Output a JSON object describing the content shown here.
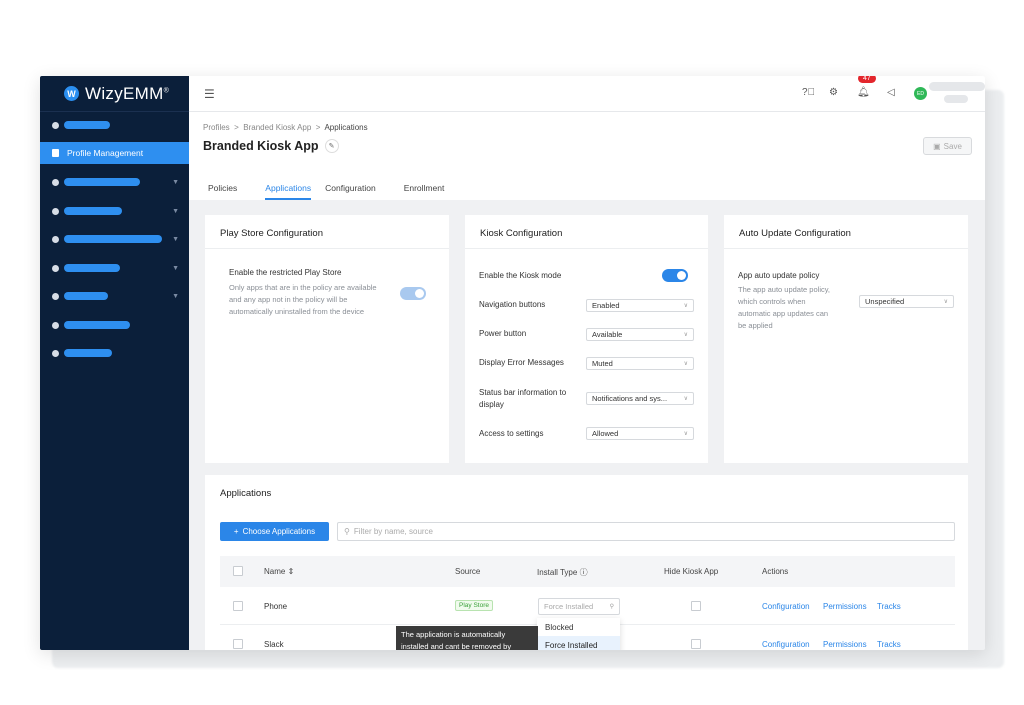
{
  "brand": {
    "name": "WizyEMM",
    "mark": "W",
    "reg": "®"
  },
  "sidebar": {
    "active_item": "Profile Management",
    "colors": {
      "bg": "#0b1f3a",
      "accent": "#2e8ff0"
    }
  },
  "header": {
    "notification_count": "47",
    "avatar_initials": "ED"
  },
  "breadcrumb": {
    "items": [
      "Profiles",
      "Branded Kiosk App",
      "Applications"
    ],
    "sep": ">"
  },
  "page": {
    "title": "Branded Kiosk App",
    "save_label": "Save"
  },
  "tabs": [
    "Policies",
    "Applications",
    "Configuration",
    "Enrollment"
  ],
  "play_store": {
    "title": "Play Store Configuration",
    "label": "Enable the restricted Play Store",
    "desc_lines": [
      "Only apps that are in the policy are available",
      "and any app not in the policy will be",
      "automatically uninstalled from the device"
    ]
  },
  "kiosk": {
    "title": "Kiosk Configuration",
    "enable_label": "Enable the Kiosk mode",
    "nav_label": "Navigation buttons",
    "nav_value": "Enabled",
    "power_label": "Power button",
    "power_value": "Available",
    "error_label": "Display Error Messages",
    "error_value": "Muted",
    "status_label_1": "Status bar information to",
    "status_label_2": "display",
    "status_value": "Notifications and sys...",
    "access_label": "Access to settings",
    "access_value": "Allowed"
  },
  "auto_update": {
    "title": "Auto Update Configuration",
    "label": "App auto update policy",
    "desc_lines": [
      "The app auto update policy,",
      "which controls when",
      "automatic app updates can",
      "be applied"
    ],
    "value": "Unspecified"
  },
  "applications": {
    "title": "Applications",
    "choose_label": "Choose Applications",
    "filter_placeholder": "Filter by name, source",
    "columns": {
      "name": "Name",
      "source": "Source",
      "install_type": "Install Type",
      "hide": "Hide Kiosk App",
      "actions": "Actions"
    },
    "rows": [
      {
        "name": "Phone",
        "source": "Play Store",
        "install_placeholder": "Force Installed"
      },
      {
        "name": "Slack"
      }
    ],
    "action_links": [
      "Configuration",
      "Permissions",
      "Tracks"
    ],
    "install_menu": [
      "Blocked",
      "Force Installed"
    ],
    "tooltip_lines": [
      "The application is automatically",
      "installed and cant be removed by"
    ]
  }
}
